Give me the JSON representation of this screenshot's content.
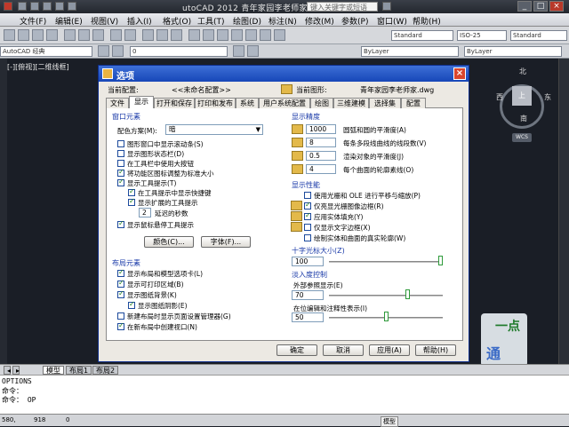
{
  "app": {
    "title": "utoCAD 2012   青年家园李老师家.dw",
    "search_placeholder": "键入关键字或短语",
    "menu": [
      "文件(F)",
      "编辑(E)",
      "视图(V)",
      "插入(I)",
      "格式(O)",
      "工具(T)",
      "绘图(D)",
      "标注(N)",
      "修改(M)",
      "参数(P)",
      "窗口(W)",
      "帮助(H)"
    ],
    "toolbar_combo1": "AutoCAD 经典",
    "toolbar_combo2": "Standard",
    "toolbar_combo3": "ISO-25",
    "toolbar_combo4": "Standard",
    "layer_combo": "0",
    "bylayer1": "ByLayer",
    "bylayer2": "ByLayer",
    "viewport_label": "[-][俯视][二维线框]",
    "viewcube": {
      "north": "北",
      "south": "南",
      "east": "东",
      "west": "西",
      "top": "上",
      "wcs": "WCS"
    },
    "logo": {
      "line1": "一点",
      "line2": "通"
    },
    "model_tabs": [
      "模型",
      "布局1",
      "布局2"
    ],
    "command_lines": [
      "OPTIONS",
      "命令：",
      "命令： OP"
    ],
    "status": {
      "coords1": "580,",
      "coords2": "918",
      "coords3": "0",
      "model": "模型"
    },
    "colors": {
      "dialog_title": "#1747b8",
      "section_label": "#1a3aa8",
      "accent_green": "#2e9a3a"
    }
  },
  "dialog": {
    "title": "选项",
    "current_profile_label": "当前配置:",
    "current_profile_value": "<<未命名配置>>",
    "current_drawing_label": "当前图形:",
    "current_drawing_value": "青年家园李老师家.dwg",
    "tabs": [
      "文件",
      "显示",
      "打开和保存",
      "打印和发布",
      "系统",
      "用户系统配置",
      "绘图",
      "三维建模",
      "选择集",
      "配置"
    ],
    "active_tab": "显示",
    "window_elements": {
      "label": "窗口元素",
      "color_scheme_label": "配色方案(M):",
      "color_scheme_value": "暗",
      "checkboxes": [
        {
          "label": "图形窗口中显示滚动条(S)",
          "checked": false
        },
        {
          "label": "显示图形状态栏(D)",
          "checked": false
        },
        {
          "label": "在工具栏中使用大按钮",
          "checked": false
        },
        {
          "label": "将功能区图标调整为标准大小",
          "checked": true
        },
        {
          "label": "显示工具提示(T)",
          "checked": true
        },
        {
          "label": "在工具提示中显示快捷键",
          "checked": true
        },
        {
          "label": "显示扩展的工具提示",
          "checked": true
        },
        {
          "label": "延迟的秒数",
          "value": "2"
        },
        {
          "label": "显示鼠标悬停工具提示",
          "checked": true
        }
      ],
      "colors_button": "颜色(C)...",
      "fonts_button": "字体(F)..."
    },
    "layout_elements": {
      "label": "布局元素",
      "checkboxes": [
        {
          "label": "显示布局和模型选项卡(L)",
          "checked": true
        },
        {
          "label": "显示可打印区域(B)",
          "checked": true
        },
        {
          "label": "显示图纸背景(K)",
          "checked": true
        },
        {
          "label": "显示图纸阴影(E)",
          "checked": true
        },
        {
          "label": "新建布局时显示页面设置管理器(G)",
          "checked": false
        },
        {
          "label": "在新布局中创建视口(N)",
          "checked": true
        }
      ]
    },
    "display_resolution": {
      "label": "显示精度",
      "rows": [
        {
          "value": "1000",
          "label": "圆弧和圆的平滑度(A)"
        },
        {
          "value": "8",
          "label": "每条多段线曲线的线段数(V)"
        },
        {
          "value": "0.5",
          "label": "渲染对象的平滑度(J)"
        },
        {
          "value": "4",
          "label": "每个曲面的轮廓素线(O)"
        }
      ]
    },
    "display_performance": {
      "label": "显示性能",
      "checkboxes": [
        {
          "label": "使用光栅和 OLE 进行平移与缩放(P)",
          "checked": false
        },
        {
          "label": "仅亮显光栅图像边框(R)",
          "checked": true
        },
        {
          "label": "应用实体填充(Y)",
          "checked": true
        },
        {
          "label": "仅显示文字边框(X)",
          "checked": false
        },
        {
          "label": "绘制实体和曲面的真实轮廓(W)",
          "checked": false
        }
      ]
    },
    "crosshair": {
      "label": "十字光标大小(Z)",
      "value": "100",
      "fraction": 1.0
    },
    "fade_control": {
      "label": "淡入度控制",
      "xref_label": "外部参照显示(E)",
      "xref_value": "70",
      "xref_fraction": 0.7,
      "inplace_label": "在位编辑和注释性表示(I)",
      "inplace_value": "50",
      "inplace_fraction": 0.5
    },
    "buttons": {
      "ok": "确定",
      "cancel": "取消",
      "apply": "应用(A)",
      "help": "帮助(H)"
    }
  }
}
